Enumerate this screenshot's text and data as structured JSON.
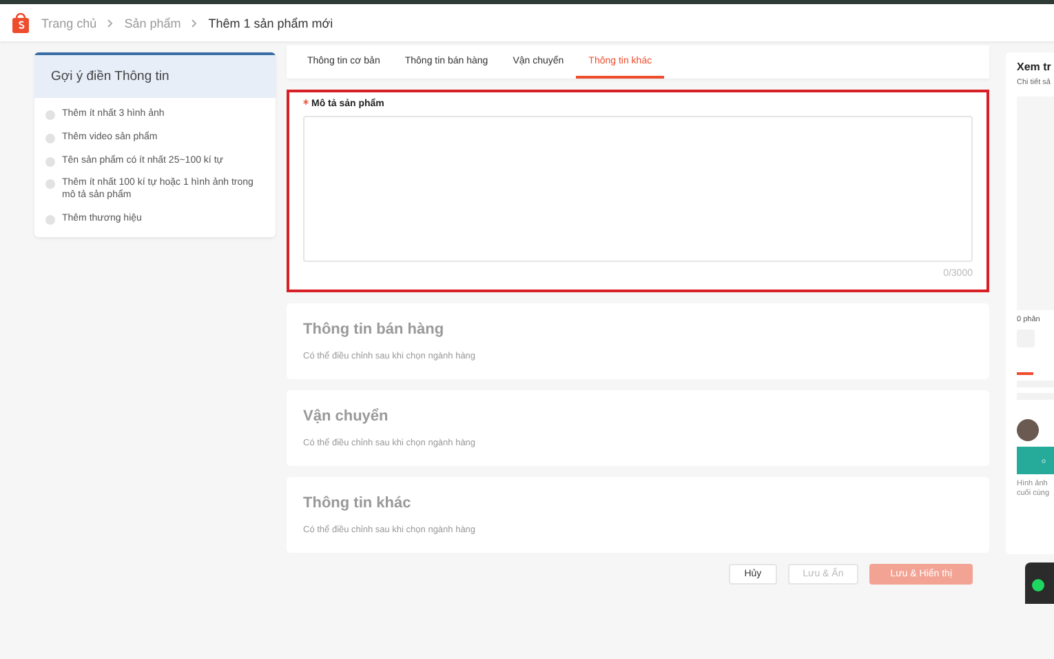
{
  "breadcrumb": [
    "Trang chủ",
    "Sản phẩm",
    "Thêm 1 sản phẩm mới"
  ],
  "suggestions": {
    "title": "Gợi ý điền Thông tin",
    "items": [
      {
        "label": "Thêm ít nhất 3 hình ảnh",
        "checked": false
      },
      {
        "label": "Thêm video sản phẩm",
        "checked": false
      },
      {
        "label": "Tên sản phẩm có ít nhất 25~100 kí tự",
        "checked": false
      },
      {
        "label": "Thêm ít nhất 100 kí tự hoặc 1 hình ảnh trong mô tả sản phẩm",
        "checked": false
      },
      {
        "label": "Thêm thương hiệu",
        "checked": false
      }
    ]
  },
  "tabs": [
    {
      "label": "Thông tin cơ bản",
      "selected": false
    },
    {
      "label": "Thông tin bán hàng",
      "selected": false
    },
    {
      "label": "Vận chuyển",
      "selected": false
    },
    {
      "label": "Thông tin khác",
      "selected": true
    }
  ],
  "description": {
    "label": "Mô tả sản phẩm",
    "required": true,
    "highlighted": true,
    "counter": "0/3000"
  },
  "sections": [
    {
      "title": "Thông tin bán hàng",
      "note": "Có thể điều chỉnh sau khi chọn ngành hàng"
    },
    {
      "title": "Vận chuyển",
      "note": "Có thể điều chỉnh sau khi chọn ngành hàng"
    },
    {
      "title": "Thông tin khác",
      "note": "Có thể điều chỉnh sau khi chọn ngành hàng"
    }
  ],
  "buttons": [
    {
      "label": "Hủy",
      "kind": "default"
    },
    {
      "label": "Lưu & Ẩn",
      "kind": "muted"
    },
    {
      "label": "Lưu & Hiển thị",
      "kind": "primary"
    }
  ],
  "preview": {
    "title": "Xem tr",
    "subtitle": "Chi tiết sả",
    "count": "0 phân",
    "caption": "Hình ảnh cuối cùng"
  }
}
